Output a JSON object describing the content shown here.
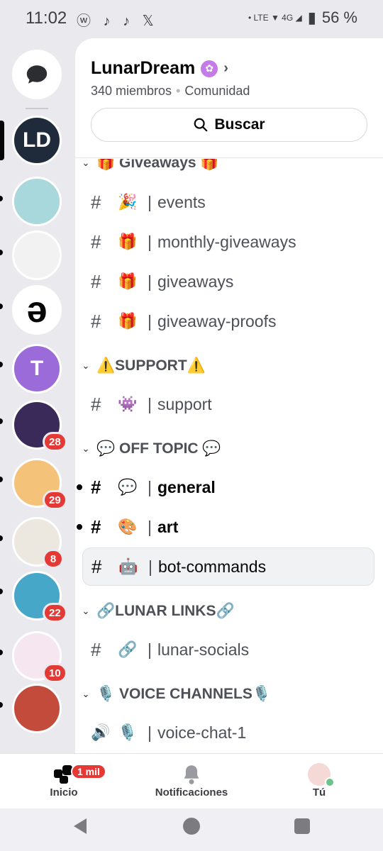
{
  "status_bar": {
    "time": "11:02",
    "app_icons": "ⓦ ♪ ♪ 𝕏",
    "indicators": "• LTE ▼ 4G ◢",
    "battery": "56 %"
  },
  "server_rail": {
    "direct_messages_icon": "chat-bubble-icon",
    "servers": [
      {
        "name": "LunarDream",
        "initials": "LD",
        "color": "#1f2a3a",
        "selected": true
      },
      {
        "name": "server-2",
        "initials": "",
        "color": "#a8d8dc"
      },
      {
        "name": "server-3",
        "initials": "",
        "color": "#f2f2f2"
      },
      {
        "name": "server-4",
        "initials": "ə",
        "color": "#ffffff"
      },
      {
        "name": "server-5",
        "initials": "T",
        "color": "#9b6bd9"
      },
      {
        "name": "server-6",
        "initials": "",
        "color": "#3a2a5a",
        "badge": "28"
      },
      {
        "name": "server-7",
        "initials": "",
        "color": "#f5c27a",
        "badge": "29"
      },
      {
        "name": "server-8",
        "initials": "",
        "color": "#ece8e0",
        "badge": "8"
      },
      {
        "name": "server-9",
        "initials": "",
        "color": "#46a7c9",
        "badge": "22"
      },
      {
        "name": "server-10",
        "initials": "",
        "color": "#f6e6ef",
        "badge": "10"
      },
      {
        "name": "server-11",
        "initials": "",
        "color": "#c24b3c"
      }
    ]
  },
  "server": {
    "name": "LunarDream",
    "members": "340 miembros",
    "type": "Comunidad",
    "search_label": "Buscar"
  },
  "categories": [
    {
      "label": "🎁 Giveaways 🎁"
    },
    {
      "label": "⚠️SUPPORT⚠️"
    },
    {
      "label": "💬 OFF TOPIC 💬"
    },
    {
      "label": "🔗LUNAR LINKS🔗"
    },
    {
      "label": "🎙️ VOICE CHANNELS🎙️"
    }
  ],
  "channels": [
    {
      "emoji": "🎉",
      "name": "events"
    },
    {
      "emoji": "🎁",
      "name": "monthly-giveaways"
    },
    {
      "emoji": "🎁",
      "name": "giveaways"
    },
    {
      "emoji": "🎁",
      "name": "giveaway-proofs"
    },
    {
      "emoji": "👾",
      "name": "support"
    },
    {
      "emoji": "💬",
      "name": "general",
      "unread": true
    },
    {
      "emoji": "🎨",
      "name": "art",
      "unread": true
    },
    {
      "emoji": "🤖",
      "name": "bot-commands",
      "selected": true
    },
    {
      "emoji": "🔗",
      "name": "lunar-socials"
    },
    {
      "emoji": "🎙️",
      "name": "voice-chat-1",
      "voice": true
    }
  ],
  "bottom_nav": {
    "home_label": "Inicio",
    "home_badge": "1 mil",
    "notifications_label": "Notificaciones",
    "you_label": "Tú"
  }
}
